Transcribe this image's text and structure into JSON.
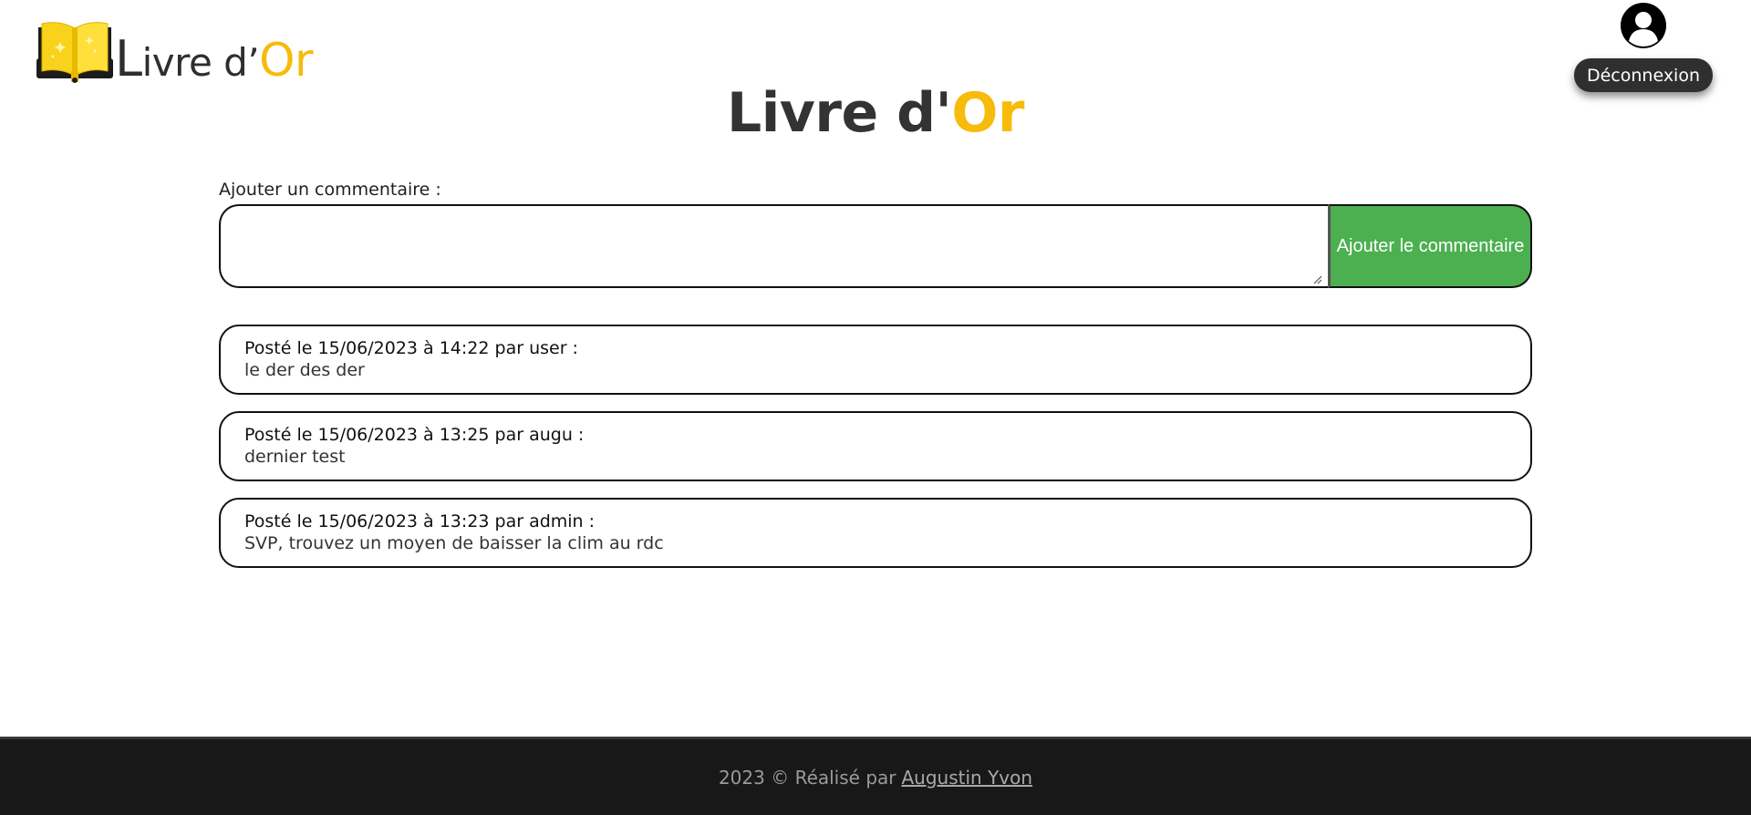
{
  "header": {
    "logo": {
      "text_main": "ivre d’",
      "text_initial": "L",
      "text_gold": "Or",
      "icon": "open-book-icon"
    },
    "user": {
      "avatar_icon": "user-avatar-icon",
      "logout_label": "Déconnexion"
    }
  },
  "title": {
    "main": "Livre d'",
    "gold": "Or"
  },
  "form": {
    "label": "Ajouter un commentaire :",
    "textarea_value": "",
    "submit_label": "Ajouter le commentaire"
  },
  "comments": [
    {
      "meta": "Posté le 15/06/2023 à 14:22 par user :",
      "body": "le der des der"
    },
    {
      "meta": "Posté le 15/06/2023 à 13:25 par augu :",
      "body": "dernier test"
    },
    {
      "meta": "Posté le 15/06/2023 à 13:23 par admin :",
      "body": "SVP, trouvez un moyen de baisser la clim au rdc"
    }
  ],
  "footer": {
    "text": "2023 © Réalisé par",
    "link_label": "Augustin Yvon"
  },
  "colors": {
    "accent_gold": "#f7bb0c",
    "submit_green": "#4cb050",
    "footer_bg": "#181818",
    "title_dark": "#333333"
  }
}
